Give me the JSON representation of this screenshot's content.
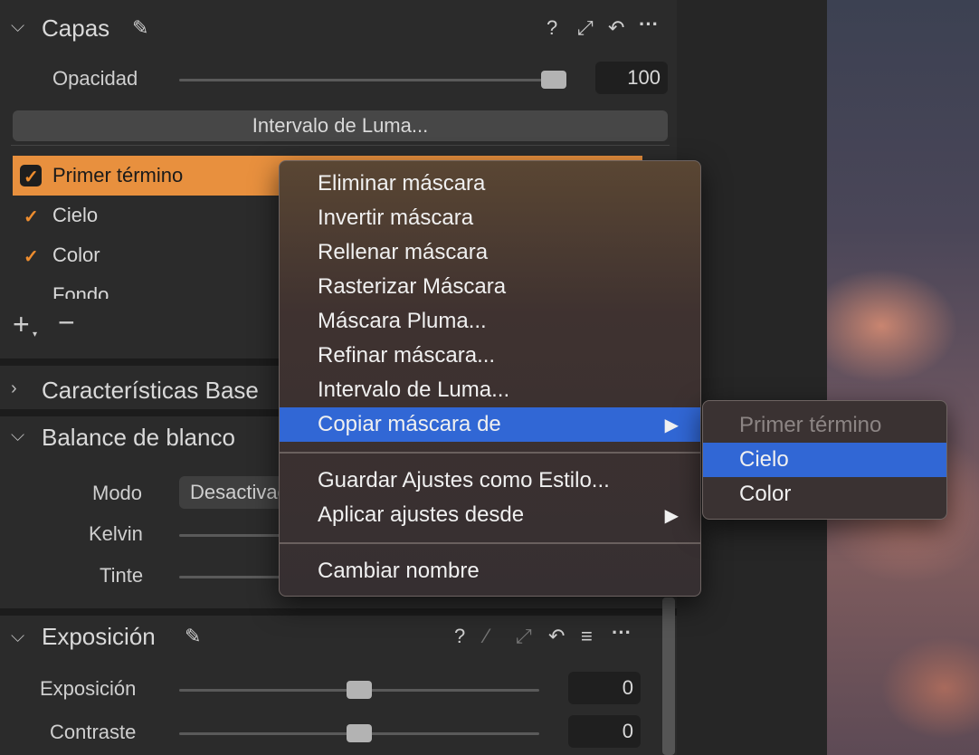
{
  "layers": {
    "title": "Capas",
    "opacity_label": "Opacidad",
    "opacity_value": "100",
    "opacity_fraction": 0.88,
    "luma_button": "Intervalo de Luma...",
    "items": [
      {
        "label": "Primer término",
        "checked": true,
        "selected": true
      },
      {
        "label": "Cielo",
        "checked": true,
        "selected": false
      },
      {
        "label": "Color",
        "checked": true,
        "selected": false
      },
      {
        "label": "Fondo",
        "checked": false,
        "selected": false
      }
    ],
    "add_icon": "plus-icon",
    "remove_icon": "minus-icon"
  },
  "base_characteristics": {
    "title": "Características Base"
  },
  "white_balance": {
    "title": "Balance de blanco",
    "mode_label": "Modo",
    "mode_value": "Desactivado",
    "kelvin_label": "Kelvin",
    "tint_label": "Tinte"
  },
  "exposure": {
    "title": "Exposición",
    "exposure_label": "Exposición",
    "exposure_value": "0",
    "contrast_label": "Contraste",
    "contrast_value": "0"
  },
  "header_icons": {
    "help": "?",
    "brush": "brush-icon",
    "expand": "expand-icon",
    "reset": "reset-icon",
    "more": "···",
    "list": "list-icon",
    "picker": "picker-icon"
  },
  "context_menu": {
    "items": [
      "Eliminar máscara",
      "Invertir máscara",
      "Rellenar máscara",
      "Rasterizar Máscara",
      "Máscara Pluma...",
      "Refinar máscara...",
      "Intervalo de Luma...",
      "Copiar máscara de"
    ],
    "items2": [
      "Guardar Ajustes como Estilo...",
      "Aplicar ajustes desde"
    ],
    "items3": [
      "Cambiar nombre"
    ],
    "submenu_arrow": "▶"
  },
  "submenu": {
    "items": [
      "Primer término",
      "Cielo",
      "Color"
    ]
  },
  "colors": {
    "accent": "#e8903e",
    "highlight": "#3167d5"
  }
}
